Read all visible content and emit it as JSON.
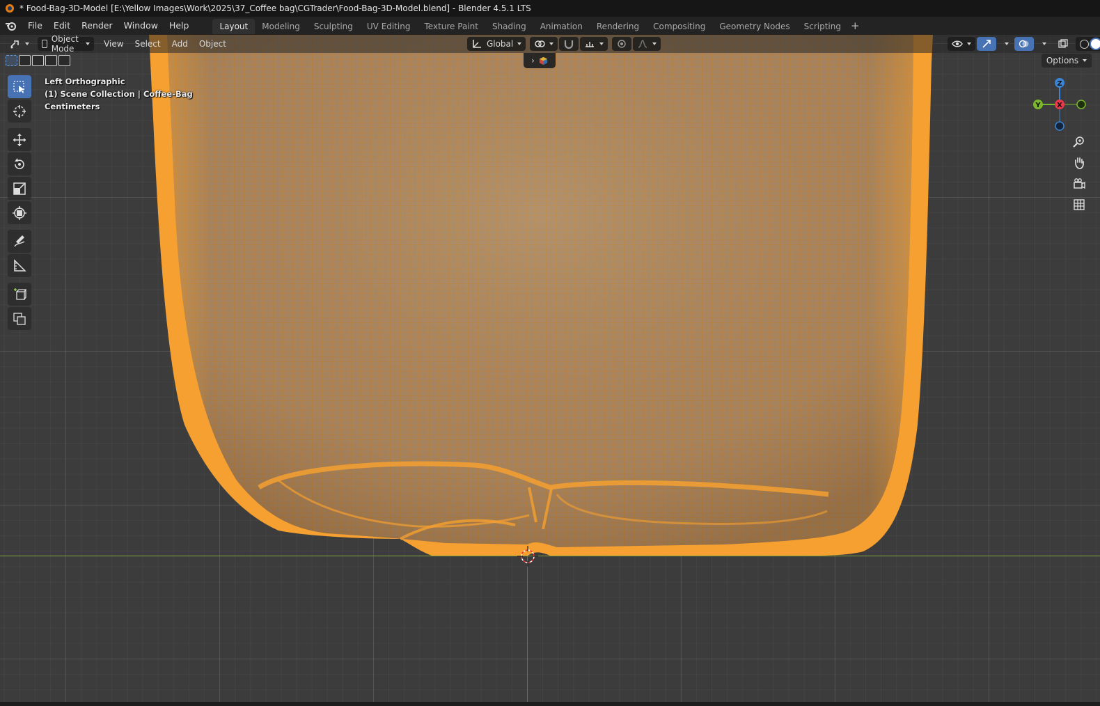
{
  "window": {
    "title": "* Food-Bag-3D-Model [E:\\Yellow Images\\Work\\2025\\37_Coffee bag\\CGTrader\\Food-Bag-3D-Model.blend] - Blender 4.5.1 LTS"
  },
  "menu": {
    "items": [
      "File",
      "Edit",
      "Render",
      "Window",
      "Help"
    ]
  },
  "workspaces": {
    "tabs": [
      "Layout",
      "Modeling",
      "Sculpting",
      "UV Editing",
      "Texture Paint",
      "Shading",
      "Animation",
      "Rendering",
      "Compositing",
      "Geometry Nodes",
      "Scripting"
    ],
    "active": "Layout",
    "add_label": "+"
  },
  "viewport_header": {
    "mode": "Object Mode",
    "menus": [
      "View",
      "Select",
      "Add",
      "Object"
    ],
    "transform_orientation": "Global",
    "options_label": "Options"
  },
  "overlay": {
    "view_name": "Left Orthographic",
    "collection": "(1) Scene Collection | Coffee-Bag",
    "units": "Centimeters"
  },
  "gizmo": {
    "z": "Z",
    "y": "Y",
    "x": "X"
  },
  "colors": {
    "selection_orange": "#f5a030",
    "mesh_fill": "#9a8066",
    "active_tool": "#4772b3",
    "axis_x": "#e8394a",
    "axis_y": "#7cb82d",
    "axis_z": "#3a85d6",
    "floor_line": "#7fa23d"
  }
}
